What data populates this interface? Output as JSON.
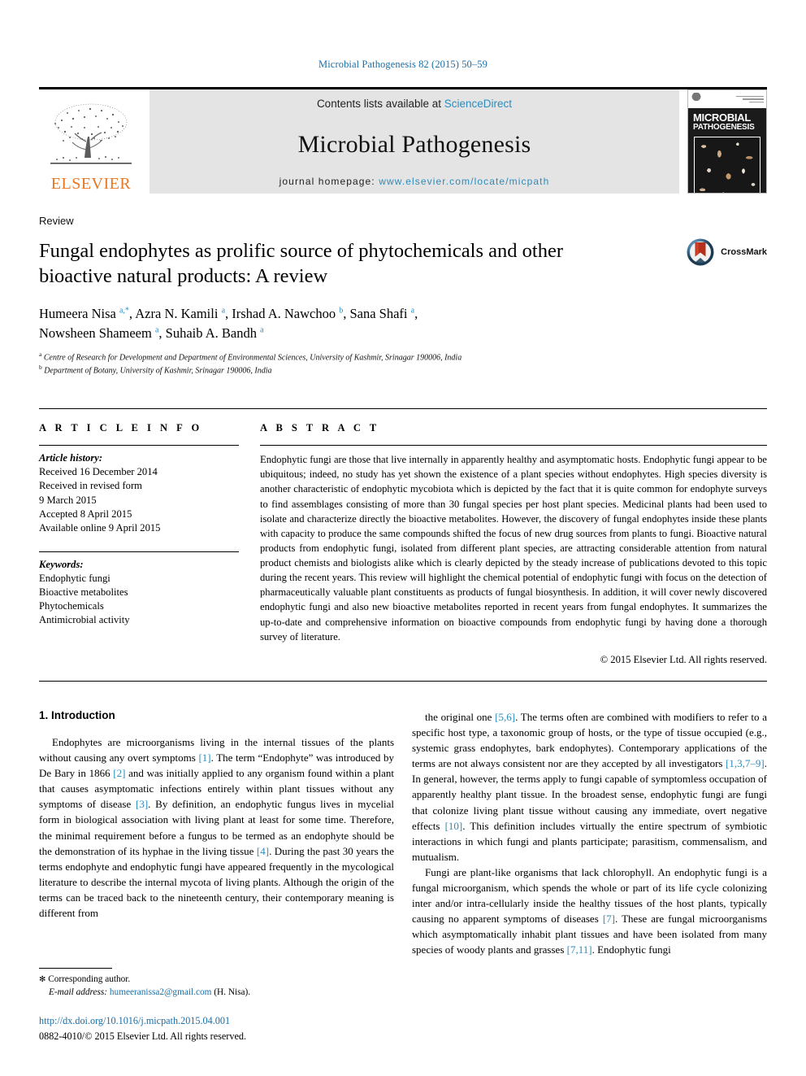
{
  "running_head": "Microbial Pathogenesis 82 (2015) 50–59",
  "masthead": {
    "publisher_name": "ELSEVIER",
    "contents_prefix": "Contents lists available at ",
    "contents_link": "ScienceDirect",
    "journal_name": "Microbial Pathogenesis",
    "homepage_prefix": "journal homepage: ",
    "homepage_url": "www.elsevier.com/locate/micpath",
    "cover": {
      "title_line1": "MICROBIAL",
      "title_line2": "PATHOGENESIS"
    }
  },
  "article": {
    "doctype": "Review",
    "title": "Fungal endophytes as prolific source of phytochemicals and other bioactive natural products: A review",
    "authors_line1": "Humeera Nisa a,*, Azra N. Kamili a, Irshad A. Nawchoo b, Sana Shafi a,",
    "authors_line2": "Nowsheen Shameem a, Suhaib A. Bandh a",
    "affiliation_a": "Centre of Research for Development and Department of Environmental Sciences, University of Kashmir, Srinagar 190006, India",
    "affiliation_b": "Department of Botany, University of Kashmir, Srinagar 190006, India",
    "crossmark_label": "CrossMark"
  },
  "article_info": {
    "heading": "A R T I C L E   I N F O",
    "history_title": "Article history:",
    "history": [
      "Received 16 December 2014",
      "Received in revised form",
      "9 March 2015",
      "Accepted 8 April 2015",
      "Available online 9 April 2015"
    ],
    "keywords_title": "Keywords:",
    "keywords": [
      "Endophytic fungi",
      "Bioactive metabolites",
      "Phytochemicals",
      "Antimicrobial activity"
    ]
  },
  "abstract": {
    "heading": "A B S T R A C T",
    "text": "Endophytic fungi are those that live internally in apparently healthy and asymptomatic hosts. Endophytic fungi appear to be ubiquitous; indeed, no study has yet shown the existence of a plant species without endophytes. High species diversity is another characteristic of endophytic mycobiota which is depicted by the fact that it is quite common for endophyte surveys to find assemblages consisting of more than 30 fungal species per host plant species. Medicinal plants had been used to isolate and characterize directly the bioactive metabolites. However, the discovery of fungal endophytes inside these plants with capacity to produce the same compounds shifted the focus of new drug sources from plants to fungi. Bioactive natural products from endophytic fungi, isolated from different plant species, are attracting considerable attention from natural product chemists and biologists alike which is clearly depicted by the steady increase of publications devoted to this topic during the recent years. This review will highlight the chemical potential of endophytic fungi with focus on the detection of pharmaceutically valuable plant constituents as products of fungal biosynthesis. In addition, it will cover newly discovered endophytic fungi and also new bioactive metabolites reported in recent years from fungal endophytes. It summarizes the up-to-date and comprehensive information on bioactive compounds from endophytic fungi by having done a thorough survey of literature.",
    "copyright": "© 2015 Elsevier Ltd. All rights reserved."
  },
  "body": {
    "section_heading": "1. Introduction",
    "left_para_1": "Endophytes are microorganisms living in the internal tissues of the plants without causing any overt symptoms [1]. The term “Endophyte” was introduced by De Bary in 1866 [2] and was initially applied to any organism found within a plant that causes asymptomatic infections entirely within plant tissues without any symptoms of disease [3]. By definition, an endophytic fungus lives in mycelial form in biological association with living plant at least for some time. Therefore, the minimal requirement before a fungus to be termed as an endophyte should be the demonstration of its hyphae in the living tissue [4]. During the past 30 years the terms endophyte and endophytic fungi have appeared frequently in the mycological literature to describe the internal mycota of living plants. Although the origin of the terms can be traced back to the nineteenth century, their contemporary meaning is different from",
    "right_para_1": "the original one [5,6]. The terms often are combined with modifiers to refer to a specific host type, a taxonomic group of hosts, or the type of tissue occupied (e.g., systemic grass endophytes, bark endophytes). Contemporary applications of the terms are not always consistent nor are they accepted by all investigators [1,3,7–9]. In general, however, the terms apply to fungi capable of symptomless occupation of apparently healthy plant tissue. In the broadest sense, endophytic fungi are fungi that colonize living plant tissue without causing any immediate, overt negative effects [10]. This definition includes virtually the entire spectrum of symbiotic interactions in which fungi and plants participate; parasitism, commensalism, and mutualism.",
    "right_para_2": "Fungi are plant-like organisms that lack chlorophyll. An endophytic fungi is a fungal microorganism, which spends the whole or part of its life cycle colonizing inter and/or intra-cellularly inside the healthy tissues of the host plants, typically causing no apparent symptoms of diseases [7]. These are fungal microorganisms which asymptomatically inhabit plant tissues and have been isolated from many species of woody plants and grasses [7,11]. Endophytic fungi"
  },
  "footnotes": {
    "corresponding": "Corresponding author.",
    "email_label": "E-mail address:",
    "email": "humeeranissa2@gmail.com",
    "email_suffix": "(H. Nisa).",
    "doi": "http://dx.doi.org/10.1016/j.micpath.2015.04.001",
    "issn_line": "0882-4010/© 2015 Elsevier Ltd. All rights reserved."
  },
  "colors": {
    "link": "#2b8cbe",
    "elsevier_orange": "#e87722",
    "masthead_gray": "#e4e4e4"
  }
}
